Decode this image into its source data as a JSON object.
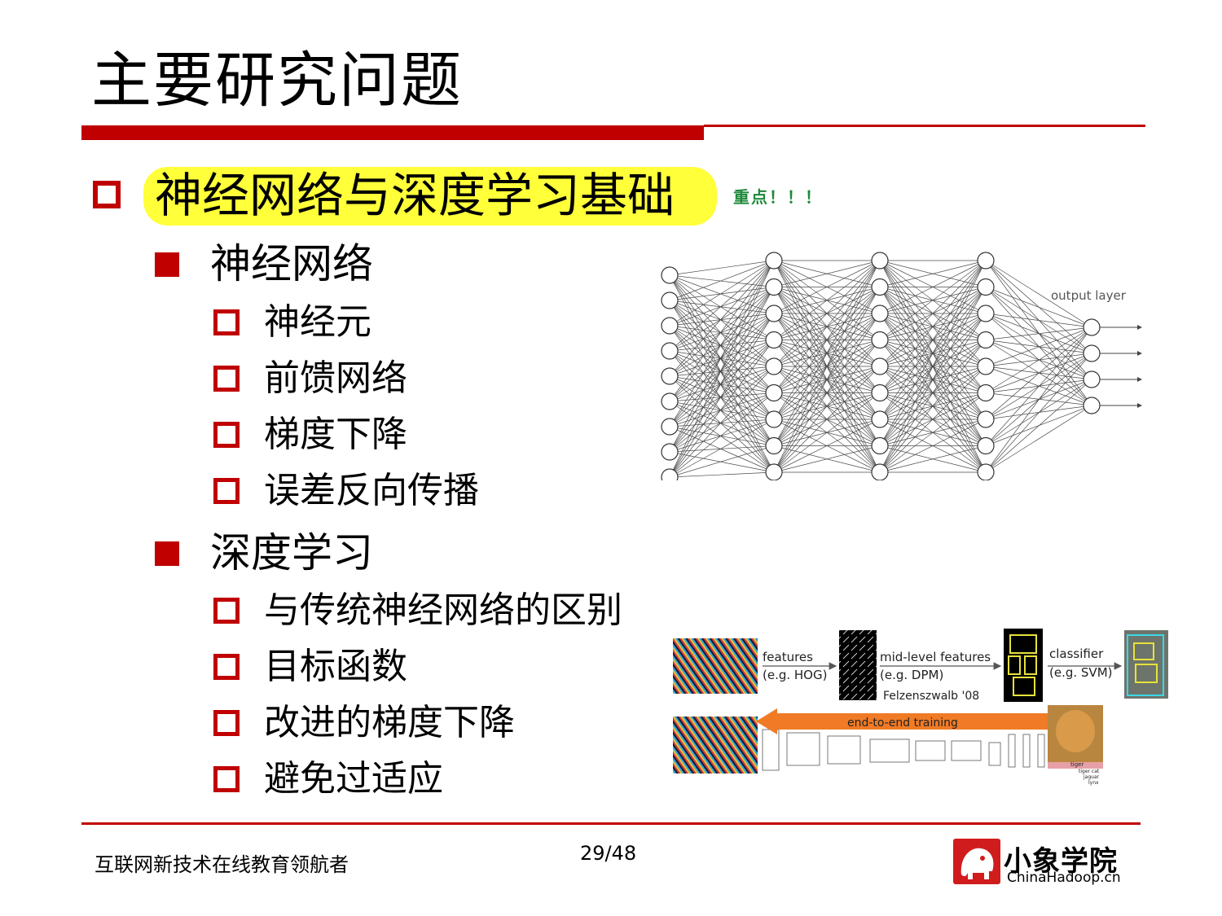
{
  "slide": {
    "title": "主要研究问题",
    "main_topic": "神经网络与深度学习基础",
    "emphasis": "重点！！！",
    "sections": [
      {
        "label": "神经网络",
        "items": [
          "神经元",
          "前馈网络",
          "梯度下降",
          "误差反向传播"
        ]
      },
      {
        "label": "深度学习",
        "items": [
          "与传统神经网络的区别",
          "目标函数",
          "改进的梯度下降",
          "避免过适应"
        ]
      }
    ]
  },
  "network_figure": {
    "output_label": "output layer"
  },
  "pipeline_figure": {
    "features_label": "features",
    "features_example": "(e.g. HOG)",
    "mid_label": "mid-level features",
    "mid_example": "(e.g. DPM)",
    "mid_citation": "Felzenszwalb '08",
    "classifier_label": "classifier",
    "classifier_example": "(e.g. SVM)",
    "e2e_label": "end-to-end training",
    "predictions": [
      "tiger",
      "tiger cat",
      "jaguar",
      "lynx"
    ]
  },
  "footer": {
    "slogan": "互联网新技术在线教育领航者",
    "page": "29/48",
    "logo_name": "小象学院",
    "logo_site": "ChinaHadoop.cn"
  },
  "colors": {
    "accent_red": "#c00000",
    "highlight_yellow": "#ffff3a",
    "emphasis_green": "#1f8a3a",
    "arrow_orange": "#f07a25"
  }
}
